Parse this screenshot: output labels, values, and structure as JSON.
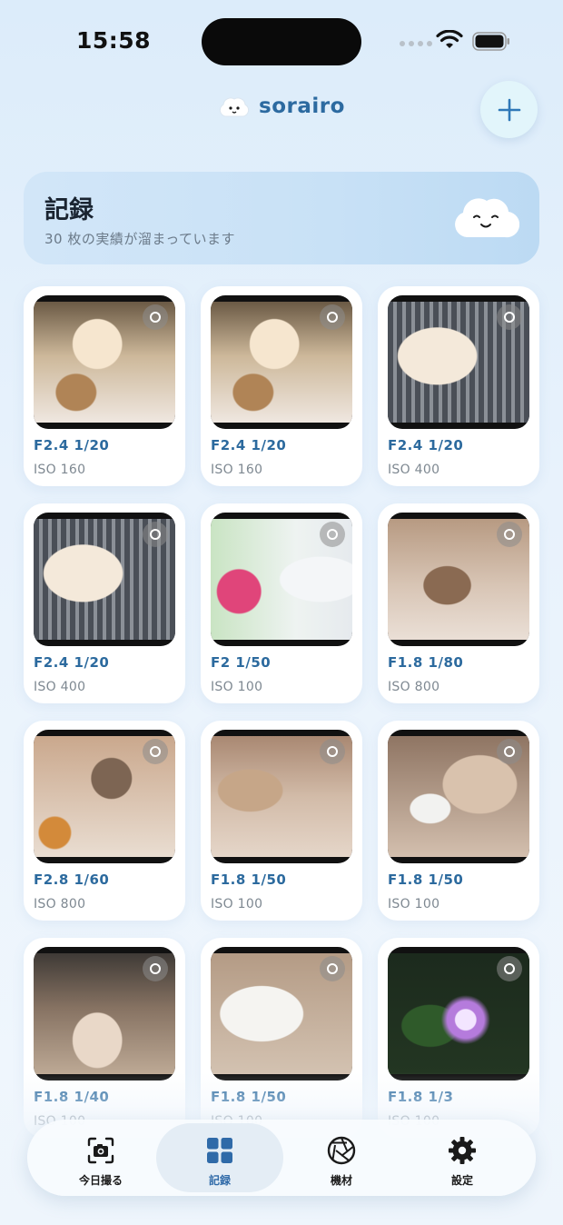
{
  "status_bar": {
    "time": "15:58"
  },
  "header": {
    "app_name": "sorairo",
    "add_icon": "plus-icon"
  },
  "banner": {
    "title": "記録",
    "subtitle": "30 枚の実績が溜まっています"
  },
  "photos": [
    {
      "exposure": "F2.4  1/20",
      "iso": "ISO 160",
      "subject": "chihuahua-on-scale"
    },
    {
      "exposure": "F2.4  1/20",
      "iso": "ISO 160",
      "subject": "chihuahua-on-scale"
    },
    {
      "exposure": "F2.4  1/20",
      "iso": "ISO 400",
      "subject": "chihuahua-barking"
    },
    {
      "exposure": "F2.4  1/20",
      "iso": "ISO 400",
      "subject": "chihuahua-barking"
    },
    {
      "exposure": "F2  1/50",
      "iso": "ISO 100",
      "subject": "white-cat-flowers"
    },
    {
      "exposure": "F1.8  1/80",
      "iso": "ISO 800",
      "subject": "calico-lying"
    },
    {
      "exposure": "F2.8  1/60",
      "iso": "ISO 800",
      "subject": "calico-bowl"
    },
    {
      "exposure": "F1.8  1/50",
      "iso": "ISO 100",
      "subject": "cat-walking"
    },
    {
      "exposure": "F1.8  1/50",
      "iso": "ISO 100",
      "subject": "cat-drinking"
    },
    {
      "exposure": "F1.8  1/40",
      "iso": "ISO 100",
      "subject": "cat-on-towel"
    },
    {
      "exposure": "F1.8  1/50",
      "iso": "ISO 100",
      "subject": "white-cat-closeup"
    },
    {
      "exposure": "F1.8  1/3",
      "iso": "ISO 100",
      "subject": "aquarium-light"
    }
  ],
  "tab_bar": {
    "tabs": [
      {
        "label": "今日撮る",
        "icon": "camera-icon",
        "active": false
      },
      {
        "label": "記録",
        "icon": "grid-icon",
        "active": true
      },
      {
        "label": "機材",
        "icon": "aperture-icon",
        "active": false
      },
      {
        "label": "設定",
        "icon": "gear-icon",
        "active": false
      }
    ]
  },
  "colors": {
    "accent": "#2c6aa0",
    "exposure_text": "#2c6a9e",
    "active_tab_bg": "#e4edf5"
  }
}
